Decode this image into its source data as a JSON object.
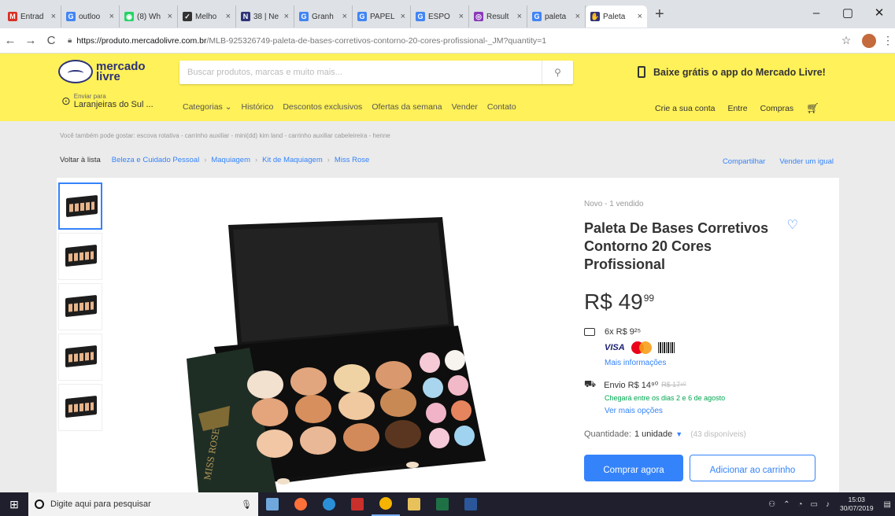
{
  "browser": {
    "tabs": [
      {
        "label": "Entrad",
        "color": "#d93025",
        "glyph": "M"
      },
      {
        "label": "outloo",
        "color": "#4285f4",
        "glyph": "G"
      },
      {
        "label": "(8) Wh",
        "color": "#25d366",
        "glyph": "◉"
      },
      {
        "label": "Melho",
        "color": "#333333",
        "glyph": "✓"
      },
      {
        "label": "38 | Ne",
        "color": "#2d3277",
        "glyph": "N"
      },
      {
        "label": "Granh",
        "color": "#4285f4",
        "glyph": "G"
      },
      {
        "label": "PAPEL",
        "color": "#4285f4",
        "glyph": "G"
      },
      {
        "label": "ESPO",
        "color": "#4285f4",
        "glyph": "G"
      },
      {
        "label": "Result",
        "color": "#8a3ab9",
        "glyph": "◎"
      },
      {
        "label": "paleta",
        "color": "#4285f4",
        "glyph": "G"
      },
      {
        "label": "Paleta",
        "color": "#2d3277",
        "glyph": "✋",
        "active": true
      }
    ],
    "url_host": "https://produto.mercadolivre.com.br",
    "url_path": "/MLB-925326749-paleta-de-bases-corretivos-contorno-20-cores-profissional-_JM?quantity=1"
  },
  "header": {
    "logo_line1": "mercado",
    "logo_line2": "livre",
    "search_placeholder": "Buscar produtos, marcas e muito mais...",
    "app_banner": "Baixe grátis o app do Mercado Livre!",
    "location_label": "Enviar para",
    "location_value": "Laranjeiras do Sul ...",
    "nav": [
      "Categorias ⌄",
      "Histórico",
      "Descontos exclusivos",
      "Ofertas da semana",
      "Vender",
      "Contato"
    ],
    "account": [
      "Crie a sua conta",
      "Entre",
      "Compras"
    ]
  },
  "page": {
    "related": "Você também pode gostar: escova rotativa - carrinho auxiliar - mini(dd) kim land - carrinho auxiliar cabeleireira - henne",
    "back": "Voltar à lista",
    "breadcrumbs": [
      "Beleza e Cuidado Pessoal",
      "Maquiagem",
      "Kit de Maquiagem",
      "Miss Rose"
    ],
    "share": "Compartilhar",
    "sell_same": "Vender um igual"
  },
  "product": {
    "condition": "Novo - 1 vendido",
    "title": "Paleta De Bases Corretivos Contorno 20 Cores Profissional",
    "price_main": "R$ 49",
    "price_cents": "99",
    "installments": "6x R$ 9²⁵",
    "visa": "VISA",
    "more_info": "Mais informações",
    "shipping": "Envio R$ 14⁹⁰",
    "shipping_old": "R$ 17⁹⁰",
    "arrival": "Chegará entre os dias 2 e 6 de agosto",
    "more_options": "Ver mais opções",
    "qty_label": "Quantidade:",
    "qty_value": "1 unidade",
    "qty_available": "(43 disponíveis)",
    "buy_now": "Comprar agora",
    "add_cart": "Adicionar ao carrinho",
    "brand_on_case": "MISS ROSE"
  },
  "colors": {
    "ml_yellow": "#fff159",
    "ml_blue": "#3483fa"
  },
  "taskbar": {
    "search_placeholder": "Digite aqui para pesquisar",
    "time": "15:03",
    "date": "30/07/2019"
  }
}
